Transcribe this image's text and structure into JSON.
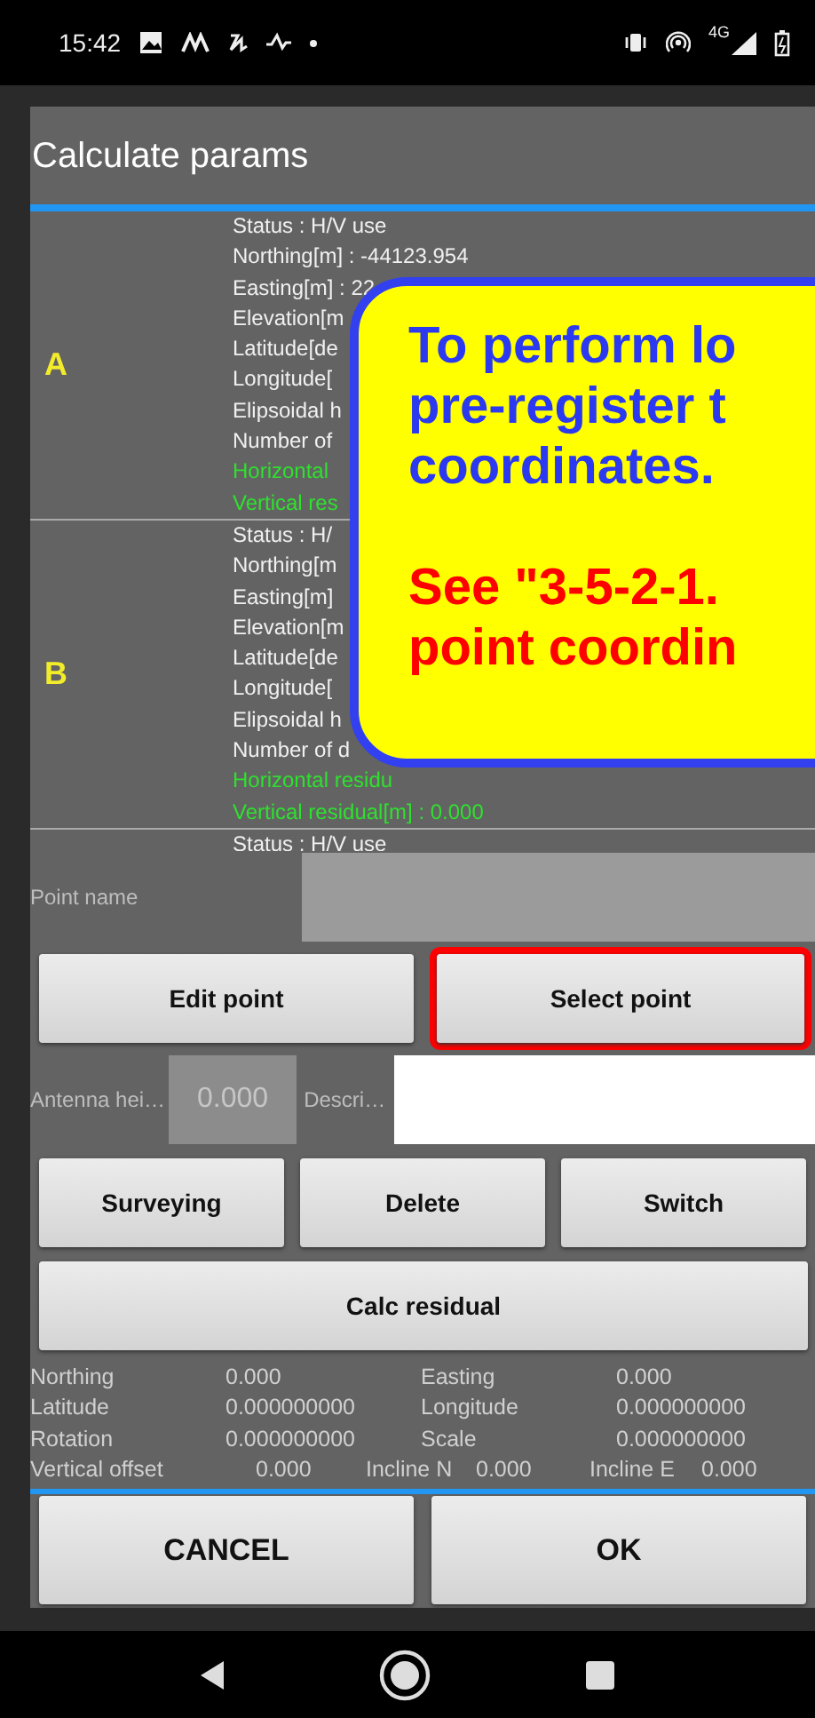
{
  "status_bar": {
    "time": "15:42",
    "network": "4G"
  },
  "dialog": {
    "title": "Calculate params",
    "points": [
      {
        "label": "A",
        "lines": [
          {
            "text": "Status : H/V use",
            "kind": "info"
          },
          {
            "text": "Northing[m] : -44123.954",
            "kind": "info"
          },
          {
            "text": "Easting[m] : 22",
            "kind": "info"
          },
          {
            "text": "Elevation[m",
            "kind": "info"
          },
          {
            "text": "Latitude[de",
            "kind": "info"
          },
          {
            "text": "Longitude[",
            "kind": "info"
          },
          {
            "text": "Elipsoidal h",
            "kind": "info"
          },
          {
            "text": "Number of",
            "kind": "info"
          },
          {
            "text": "Horizontal",
            "kind": "residual"
          },
          {
            "text": "Vertical res",
            "kind": "residual"
          }
        ]
      },
      {
        "label": "B",
        "lines": [
          {
            "text": "Status : H/",
            "kind": "info"
          },
          {
            "text": "Northing[m",
            "kind": "info"
          },
          {
            "text": "Easting[m]",
            "kind": "info"
          },
          {
            "text": "Elevation[m",
            "kind": "info"
          },
          {
            "text": "Latitude[de",
            "kind": "info"
          },
          {
            "text": "Longitude[",
            "kind": "info"
          },
          {
            "text": "Elipsoidal h",
            "kind": "info"
          },
          {
            "text": "Number of d",
            "kind": "info"
          },
          {
            "text": "Horizontal residu",
            "kind": "residual"
          },
          {
            "text": "Vertical residual[m] : 0.000",
            "kind": "residual"
          }
        ]
      },
      {
        "lines": [
          {
            "text": "Status : H/V use",
            "kind": "info"
          }
        ]
      }
    ],
    "point_name": {
      "label": "Point name"
    },
    "top_actions": [
      {
        "label": "Edit point",
        "highlighted": false
      },
      {
        "label": "Select point",
        "highlighted": true
      }
    ],
    "antenna": {
      "label": "Antenna hei…",
      "value": "0.000"
    },
    "description": {
      "label": "Descri…"
    },
    "actions": [
      "Surveying",
      "Delete",
      "Switch"
    ],
    "calc_button": "Calc residual",
    "results": [
      [
        {
          "label": "Northing",
          "value": "0.000"
        },
        {
          "label": "Easting",
          "value": "0.000"
        }
      ],
      [
        {
          "label": "Latitude",
          "value": "0.000000000"
        },
        {
          "label": "Longitude",
          "value": "0.000000000"
        }
      ],
      [
        {
          "label": "Rotation",
          "value": "0.000000000"
        },
        {
          "label": "Scale",
          "value": "0.000000000"
        }
      ],
      [
        {
          "label": "Vertical offset",
          "value": "0.000"
        },
        {
          "label": "Incline N",
          "value": "0.000"
        },
        {
          "label": "Incline E",
          "value": "0.000"
        }
      ]
    ],
    "buttons": [
      "CANCEL",
      "OK"
    ]
  },
  "callout": {
    "paragraphs": [
      {
        "color": "#2b3af0",
        "lines": [
          "To perform lo",
          "pre-register t",
          "coordinates."
        ]
      },
      {
        "color": "#ff0000",
        "lines": [
          "See \"3-5-2-1.",
          "point coordin"
        ]
      }
    ]
  }
}
